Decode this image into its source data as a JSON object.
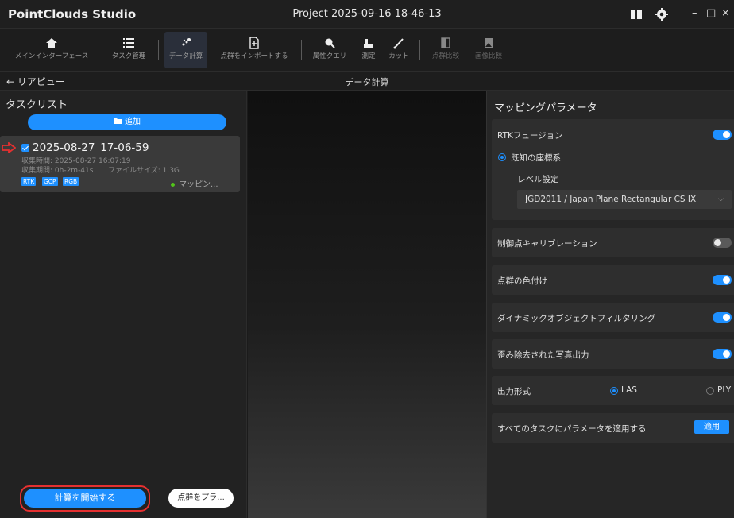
{
  "window": {
    "app_title": "PointClouds Studio",
    "project_title": "Project 2025-09-16 18-46-13",
    "controls": {
      "minimize": "–",
      "maximize": "□",
      "close": "×"
    }
  },
  "toolbar": {
    "items": [
      {
        "label": "メインインターフェース",
        "icon": "home-icon"
      },
      {
        "label": "タスク管理",
        "icon": "list-icon"
      },
      {
        "label": "データ計算",
        "icon": "compute-icon",
        "active": true
      },
      {
        "label": "点群をインポートする",
        "icon": "import-icon"
      },
      {
        "label": "属性クエリ",
        "icon": "search-icon"
      },
      {
        "label": "測定",
        "icon": "measure-icon"
      },
      {
        "label": "カット",
        "icon": "cut-icon"
      },
      {
        "label": "点群比較",
        "icon": "compare-icon",
        "disabled": true
      },
      {
        "label": "画像比較",
        "icon": "image-compare-icon",
        "disabled": true
      }
    ]
  },
  "subbar": {
    "back_label": "← リアビュー",
    "title": "データ計算"
  },
  "task_list": {
    "title": "タスクリスト",
    "add_label": "追加",
    "task": {
      "name": "2025-08-27_17-06-59",
      "collect_time": "収集時間: 2025-08-27 16:07:19",
      "collect_period": "収集期間: 0h-2m-41s",
      "file_size": "ファイルサイズ: 1.3G",
      "tags": [
        "RTK",
        "GCP",
        "RGB"
      ],
      "status": "マッピン..."
    },
    "start_label": "計算を開始する",
    "pc_label": "点群をプラ..."
  },
  "params": {
    "title": "マッピングパラメータ",
    "rtk_label": "RTKフュージョン",
    "rtk_on": true,
    "known_crs": "既知の座標系",
    "level_label": "レベル設定",
    "crs_value": "JGD2011 / Japan Plane Rectangular CS IX",
    "control_point": "制御点キャリブレーション",
    "control_point_on": false,
    "colorize": "点群の色付け",
    "colorize_on": true,
    "dyn_filter": "ダイナミックオブジェクトフィルタリング",
    "dyn_filter_on": true,
    "undistort": "歪み除去された写真出力",
    "undistort_on": true,
    "output_format": "出力形式",
    "fmt_las": "LAS",
    "fmt_ply": "PLY",
    "selected_format": "LAS",
    "apply_all": "すべてのタスクにパラメータを適用する",
    "apply_btn": "適用"
  },
  "colors": {
    "accent": "#1e90ff",
    "alert": "#e53030",
    "status_ok": "#52c41a"
  }
}
